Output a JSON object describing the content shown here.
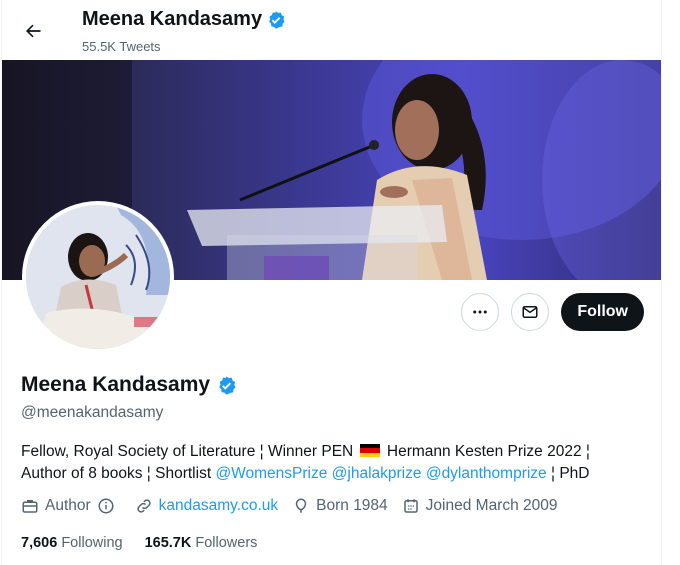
{
  "header": {
    "name": "Meena Kandasamy",
    "tweet_count": "55.5K Tweets"
  },
  "profile": {
    "name": "Meena Kandasamy",
    "handle": "@meenakandasamy",
    "bio": {
      "part1": "Fellow, Royal Society of Literature ¦ Winner PEN",
      "part2": "Hermann Kesten Prize 2022 ¦",
      "part3": "Author of 8 books ¦ Shortlist",
      "mention1": "@WomensPrize",
      "mention2": "@jhalakprize",
      "mention3": "@dylanthomprize",
      "part4": "¦ PhD"
    },
    "meta": {
      "category": "Author",
      "website": "kandasamy.co.uk",
      "born": "Born 1984",
      "joined": "Joined March 2009"
    },
    "stats": {
      "following_count": "7,606",
      "following_label": "Following",
      "followers_count": "165.7K",
      "followers_label": "Followers"
    }
  },
  "actions": {
    "follow_label": "Follow"
  },
  "icons": {
    "back": "arrow-left-icon",
    "verified": "verified-badge-icon",
    "more": "more-icon",
    "message": "envelope-icon",
    "category": "briefcase-icon",
    "info": "info-icon",
    "link": "link-icon",
    "born": "balloon-icon",
    "joined": "calendar-icon"
  },
  "colors": {
    "accent": "#1d9bf0",
    "text": "#0f1419",
    "secondary": "#536471",
    "button_dark": "#0f1419"
  }
}
